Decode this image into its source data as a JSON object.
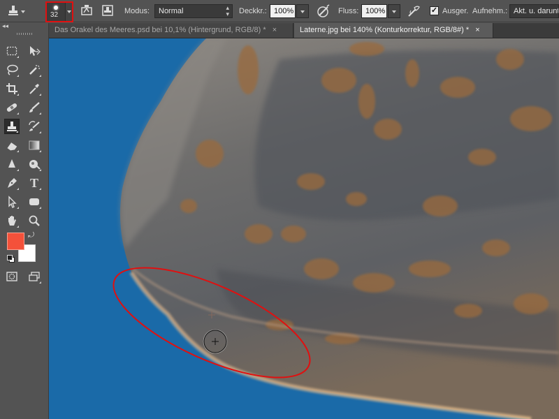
{
  "options_bar": {
    "brush_size": "32",
    "mode_label": "Modus:",
    "mode_value": "Normal",
    "opacity_label": "Deckkr.:",
    "opacity_value": "100%",
    "flow_label": "Fluss:",
    "flow_value": "100%",
    "aligned_label": "Ausger.",
    "aligned_checked": true,
    "sample_label": "Aufnehm.:",
    "sample_value": "Akt. u. darunt"
  },
  "tabs": [
    {
      "label": "Das Orakel des Meeres.psd bei 10,1% (Hintergrund, RGB/8) *",
      "close": "×",
      "active": false
    },
    {
      "label": "Laterne.jpg bei 140% (Konturkorrektur, RGB/8#) *",
      "close": "×",
      "active": true
    }
  ],
  "toolbar": {
    "collapse_glyph": "◂◂",
    "tools": [
      "rectangular-marquee-tool",
      "move-tool",
      "lasso-tool",
      "quick-selection-tool",
      "crop-tool",
      "eyedropper-tool",
      "spot-healing-brush-tool",
      "brush-tool",
      "clone-stamp-tool",
      "history-brush-tool",
      "eraser-tool",
      "gradient-tool",
      "blur-tool",
      "dodge-tool",
      "pen-tool",
      "type-tool",
      "path-selection-tool",
      "rounded-rectangle-tool",
      "hand-tool",
      "zoom-tool"
    ],
    "type_tool_glyph": "T",
    "active_tool": "clone-stamp-tool",
    "foreground_color": "#f4513a",
    "background_color": "#ffffff"
  },
  "colors": {
    "ui_background": "#535353",
    "canvas_background": "#1a6aa8",
    "highlight": "#e01010"
  }
}
